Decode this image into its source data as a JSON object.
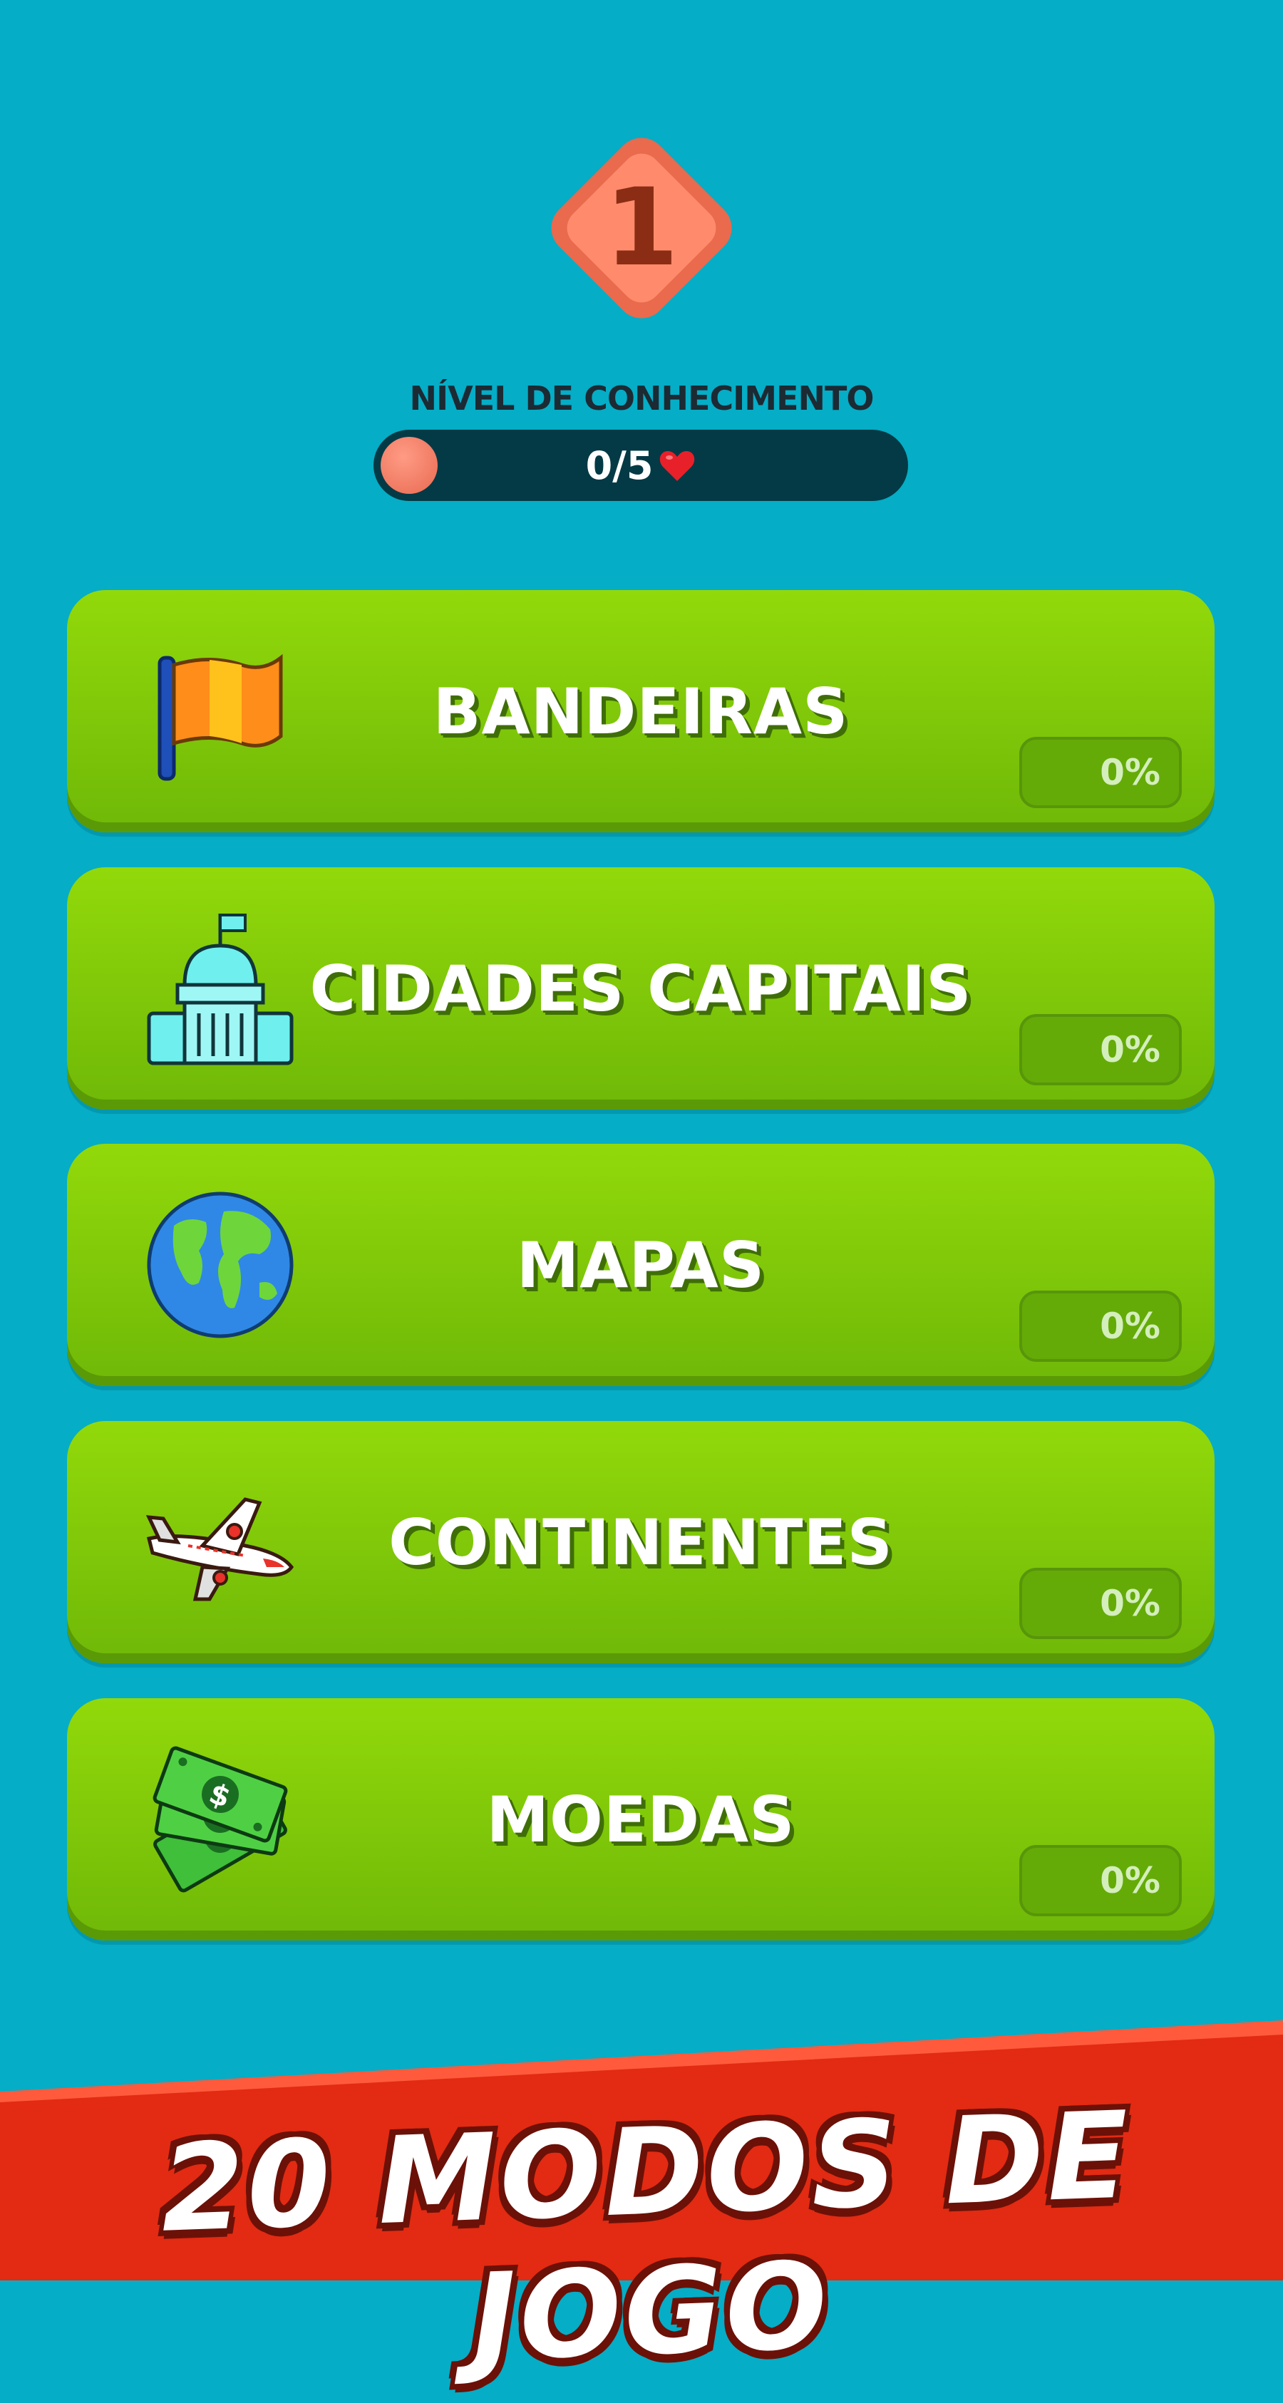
{
  "level": {
    "number": "1",
    "label": "NÍVEL DE CONHECIMENTO"
  },
  "progress": {
    "text": "0/5",
    "fraction": 0.0,
    "icon": "heart-icon"
  },
  "modes": [
    {
      "label": "BANDEIRAS",
      "percent": "0%",
      "icon": "flag-icon"
    },
    {
      "label": "CIDADES CAPITAIS",
      "percent": "0%",
      "icon": "capitol-icon"
    },
    {
      "label": "MAPAS",
      "percent": "0%",
      "icon": "globe-icon"
    },
    {
      "label": "CONTINENTES",
      "percent": "0%",
      "icon": "airplane-icon"
    },
    {
      "label": "MOEDAS",
      "percent": "0%",
      "icon": "money-icon"
    }
  ],
  "banner": {
    "text": "20 MODOS DE JOGO"
  },
  "colors": {
    "background": "#05adc6",
    "card": "#7fc80a",
    "badge": "#f28a6c",
    "banner": "#e22b12"
  }
}
